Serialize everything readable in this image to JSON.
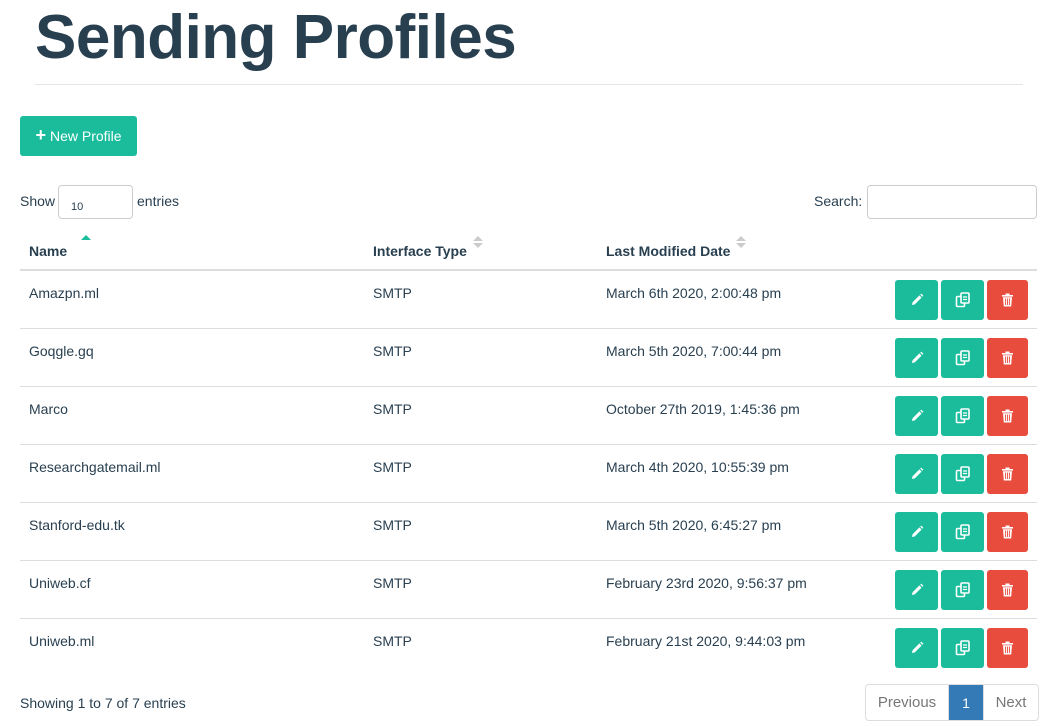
{
  "page": {
    "title": "Sending Profiles"
  },
  "toolbar": {
    "new_button_label": "New Profile"
  },
  "length_control": {
    "show_label": "Show",
    "value": "10",
    "entries_label": "entries"
  },
  "search": {
    "label": "Search:",
    "value": ""
  },
  "table": {
    "headers": {
      "name": "Name",
      "type": "Interface Type",
      "date": "Last Modified Date"
    },
    "rows": [
      {
        "name": "Amazpn.ml",
        "type": "SMTP",
        "date": "March 6th 2020, 2:00:48 pm"
      },
      {
        "name": "Goqgle.gq",
        "type": "SMTP",
        "date": "March 5th 2020, 7:00:44 pm"
      },
      {
        "name": "Marco",
        "type": "SMTP",
        "date": "October 27th 2019, 1:45:36 pm"
      },
      {
        "name": "Researchgatemail.ml",
        "type": "SMTP",
        "date": "March 4th 2020, 10:55:39 pm"
      },
      {
        "name": "Stanford-edu.tk",
        "type": "SMTP",
        "date": "March 5th 2020, 6:45:27 pm"
      },
      {
        "name": "Uniweb.cf",
        "type": "SMTP",
        "date": "February 23rd 2020, 9:56:37 pm"
      },
      {
        "name": "Uniweb.ml",
        "type": "SMTP",
        "date": "February 21st 2020, 9:44:03 pm"
      }
    ]
  },
  "footer": {
    "info": "Showing 1 to 7 of 7 entries",
    "prev_label": "Previous",
    "page_number": "1",
    "next_label": "Next"
  },
  "colors": {
    "teal": "#1abc9c",
    "red": "#e74c3c",
    "pager_active": "#337ab7",
    "text": "#283f50"
  },
  "icons": {
    "new": "plus-icon",
    "edit": "pencil-icon",
    "copy": "copy-icon",
    "delete": "trash-icon"
  }
}
